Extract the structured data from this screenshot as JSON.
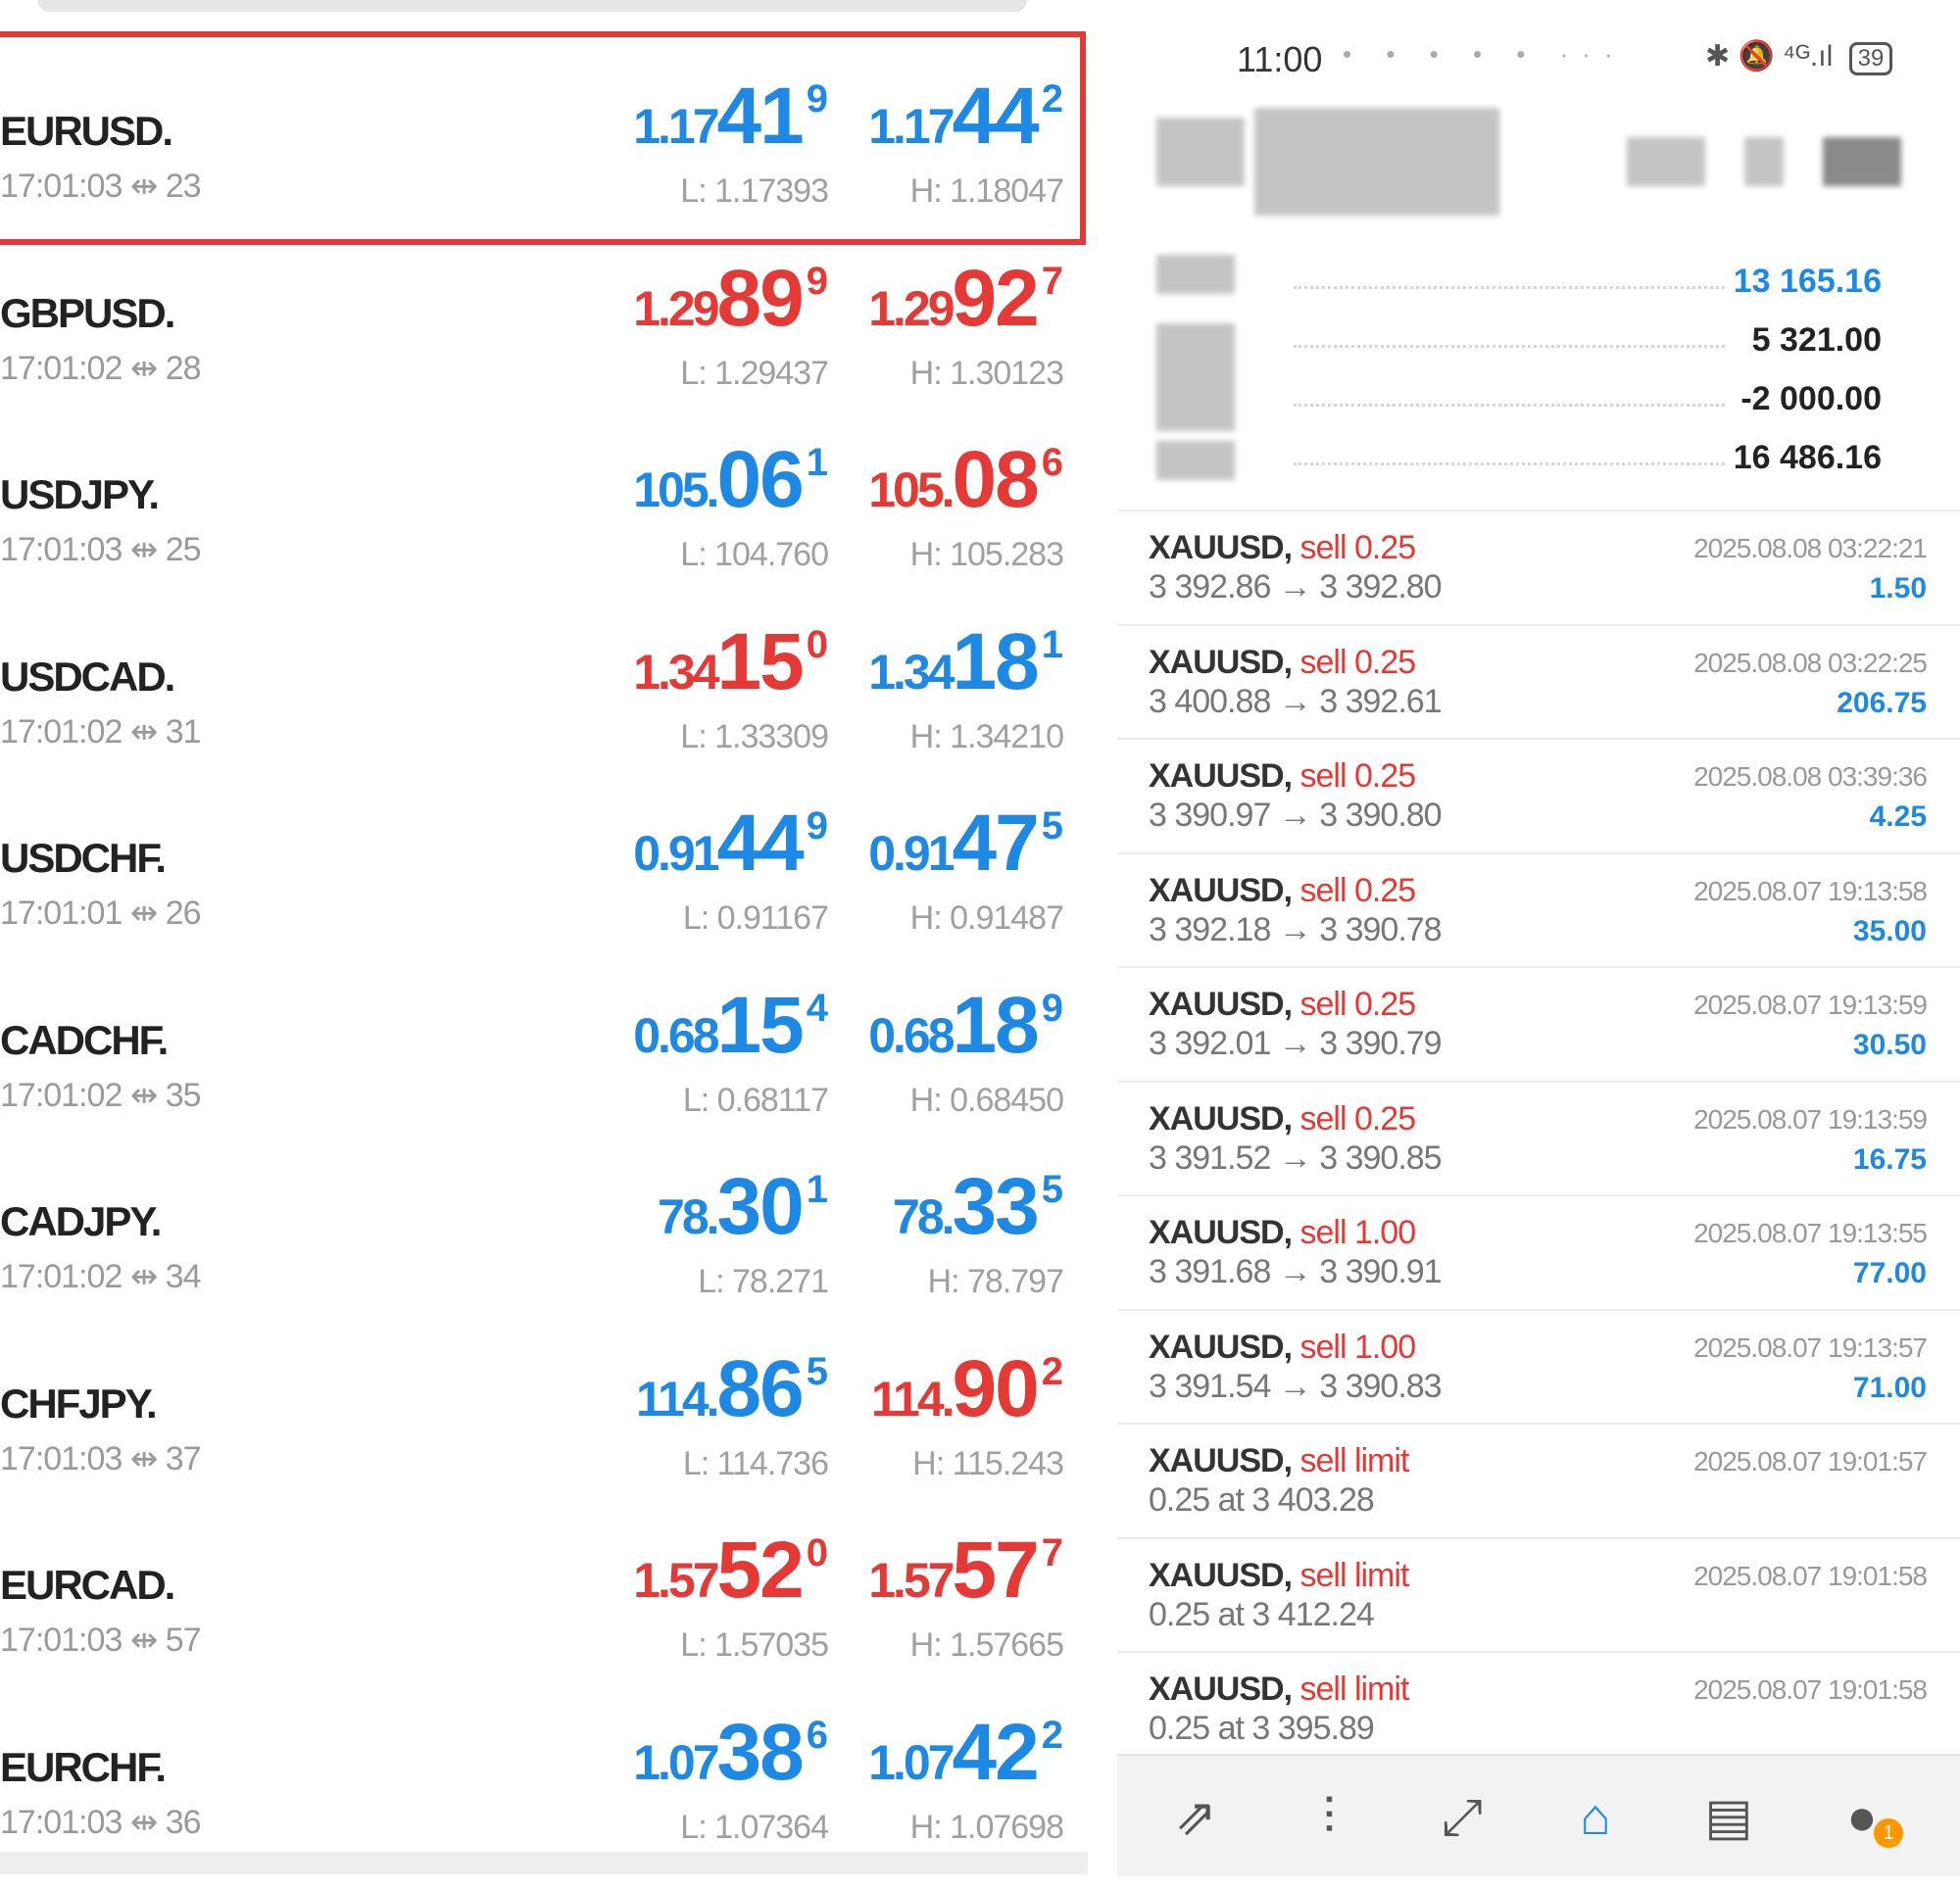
{
  "quotes": [
    {
      "symbol": "EURUSD.",
      "time": "17:01:03",
      "spread_icon": "⇹",
      "spread": "23",
      "bid": {
        "prefix": "1.17",
        "big": "41",
        "sup": "9",
        "color": "blue"
      },
      "ask": {
        "prefix": "1.17",
        "big": "44",
        "sup": "2",
        "color": "blue"
      },
      "low": "L: 1.17393",
      "high": "H: 1.18047",
      "highlighted": true
    },
    {
      "symbol": "GBPUSD.",
      "time": "17:01:02",
      "spread_icon": "⇹",
      "spread": "28",
      "bid": {
        "prefix": "1.29",
        "big": "89",
        "sup": "9",
        "color": "red"
      },
      "ask": {
        "prefix": "1.29",
        "big": "92",
        "sup": "7",
        "color": "red"
      },
      "low": "L: 1.29437",
      "high": "H: 1.30123"
    },
    {
      "symbol": "USDJPY.",
      "time": "17:01:03",
      "spread_icon": "⇹",
      "spread": "25",
      "bid": {
        "prefix": "105.",
        "big": "06",
        "sup": "1",
        "color": "blue"
      },
      "ask": {
        "prefix": "105.",
        "big": "08",
        "sup": "6",
        "color": "red"
      },
      "low": "L: 104.760",
      "high": "H: 105.283"
    },
    {
      "symbol": "USDCAD.",
      "time": "17:01:02",
      "spread_icon": "⇹",
      "spread": "31",
      "bid": {
        "prefix": "1.34",
        "big": "15",
        "sup": "0",
        "color": "red"
      },
      "ask": {
        "prefix": "1.34",
        "big": "18",
        "sup": "1",
        "color": "blue"
      },
      "low": "L: 1.33309",
      "high": "H: 1.34210"
    },
    {
      "symbol": "USDCHF.",
      "time": "17:01:01",
      "spread_icon": "⇹",
      "spread": "26",
      "bid": {
        "prefix": "0.91",
        "big": "44",
        "sup": "9",
        "color": "blue"
      },
      "ask": {
        "prefix": "0.91",
        "big": "47",
        "sup": "5",
        "color": "blue"
      },
      "low": "L: 0.91167",
      "high": "H: 0.91487"
    },
    {
      "symbol": "CADCHF.",
      "time": "17:01:02",
      "spread_icon": "⇹",
      "spread": "35",
      "bid": {
        "prefix": "0.68",
        "big": "15",
        "sup": "4",
        "color": "blue"
      },
      "ask": {
        "prefix": "0.68",
        "big": "18",
        "sup": "9",
        "color": "blue"
      },
      "low": "L: 0.68117",
      "high": "H: 0.68450"
    },
    {
      "symbol": "CADJPY.",
      "time": "17:01:02",
      "spread_icon": "⇹",
      "spread": "34",
      "bid": {
        "prefix": "78.",
        "big": "30",
        "sup": "1",
        "color": "blue"
      },
      "ask": {
        "prefix": "78.",
        "big": "33",
        "sup": "5",
        "color": "blue"
      },
      "low": "L: 78.271",
      "high": "H: 78.797"
    },
    {
      "symbol": "CHFJPY.",
      "time": "17:01:03",
      "spread_icon": "⇹",
      "spread": "37",
      "bid": {
        "prefix": "114.",
        "big": "86",
        "sup": "5",
        "color": "blue"
      },
      "ask": {
        "prefix": "114.",
        "big": "90",
        "sup": "2",
        "color": "red"
      },
      "low": "L: 114.736",
      "high": "H: 115.243"
    },
    {
      "symbol": "EURCAD.",
      "time": "17:01:03",
      "spread_icon": "⇹",
      "spread": "57",
      "bid": {
        "prefix": "1.57",
        "big": "52",
        "sup": "0",
        "color": "red"
      },
      "ask": {
        "prefix": "1.57",
        "big": "57",
        "sup": "7",
        "color": "red"
      },
      "low": "L: 1.57035",
      "high": "H: 1.57665"
    },
    {
      "symbol": "EURCHF.",
      "time": "17:01:03",
      "spread_icon": "⇹",
      "spread": "36",
      "bid": {
        "prefix": "1.07",
        "big": "38",
        "sup": "6",
        "color": "blue"
      },
      "ask": {
        "prefix": "1.07",
        "big": "42",
        "sup": "2",
        "color": "blue"
      },
      "low": "L: 1.07364",
      "high": "H: 1.07698"
    }
  ],
  "status_bar": {
    "time": "11:00",
    "dots": "• • • • • ···",
    "icons": "✱ 🔕 ⁴ᴳ.ıl",
    "battery": "39"
  },
  "summary": [
    {
      "value": "13 165.16",
      "color": "blue"
    },
    {
      "value": "5 321.00",
      "color": "black"
    },
    {
      "value": "-2 000.00",
      "color": "black"
    },
    {
      "value": "16 486.16",
      "color": "black"
    }
  ],
  "transactions": [
    {
      "symbol": "XAUUSD,",
      "type": "sell 0.25",
      "detail": "3 392.86 → 3 392.80",
      "date": "2025.08.08 03:22:21",
      "profit": "1.50"
    },
    {
      "symbol": "XAUUSD,",
      "type": "sell 0.25",
      "detail": "3 400.88 → 3 392.61",
      "date": "2025.08.08 03:22:25",
      "profit": "206.75"
    },
    {
      "symbol": "XAUUSD,",
      "type": "sell 0.25",
      "detail": "3 390.97 → 3 390.80",
      "date": "2025.08.08 03:39:36",
      "profit": "4.25"
    },
    {
      "symbol": "XAUUSD,",
      "type": "sell 0.25",
      "detail": "3 392.18 → 3 390.78",
      "date": "2025.08.07 19:13:58",
      "profit": "35.00"
    },
    {
      "symbol": "XAUUSD,",
      "type": "sell 0.25",
      "detail": "3 392.01 → 3 390.79",
      "date": "2025.08.07 19:13:59",
      "profit": "30.50"
    },
    {
      "symbol": "XAUUSD,",
      "type": "sell 0.25",
      "detail": "3 391.52 → 3 390.85",
      "date": "2025.08.07 19:13:59",
      "profit": "16.75"
    },
    {
      "symbol": "XAUUSD,",
      "type": "sell 1.00",
      "detail": "3 391.68 → 3 390.91",
      "date": "2025.08.07 19:13:55",
      "profit": "77.00"
    },
    {
      "symbol": "XAUUSD,",
      "type": "sell 1.00",
      "detail": "3 391.54 → 3 390.83",
      "date": "2025.08.07 19:13:57",
      "profit": "71.00"
    },
    {
      "symbol": "XAUUSD,",
      "type": "sell limit",
      "detail": "0.25 at 3 403.28",
      "date": "2025.08.07 19:01:57",
      "profit": ""
    },
    {
      "symbol": "XAUUSD,",
      "type": "sell limit",
      "detail": "0.25 at 3 412.24",
      "date": "2025.08.07 19:01:58",
      "profit": ""
    },
    {
      "symbol": "XAUUSD,",
      "type": "sell limit",
      "detail": "0.25 at 3 395.89",
      "date": "2025.08.07 19:01:58",
      "profit": ""
    }
  ],
  "bottom_nav": [
    {
      "icon": "quotes-icon",
      "glyph": "⇗",
      "active": false
    },
    {
      "icon": "chart-icon",
      "glyph": "⫶",
      "active": false
    },
    {
      "icon": "trade-icon",
      "glyph": "⤢",
      "active": false
    },
    {
      "icon": "history-icon",
      "glyph": "⌂",
      "active": true
    },
    {
      "icon": "news-icon",
      "glyph": "▤",
      "active": false
    },
    {
      "icon": "messages-icon",
      "glyph": "●",
      "active": false,
      "badge": "1"
    }
  ],
  "colors": {
    "blue": "#1e88e5",
    "red": "#e53935",
    "highlight_border": "#e53935"
  }
}
